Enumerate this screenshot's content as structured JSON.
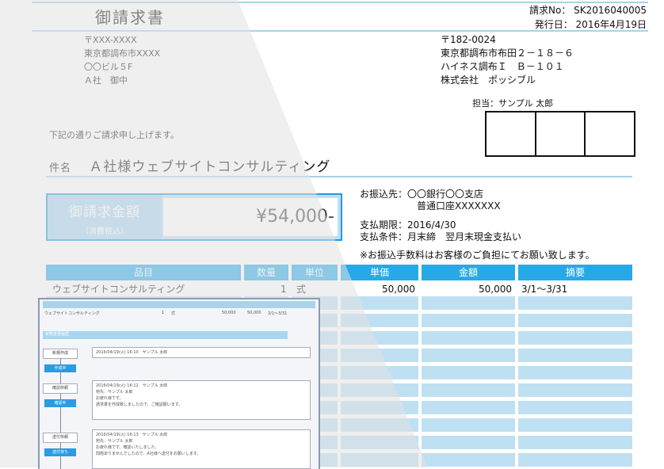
{
  "invoice": {
    "title": "御請求書",
    "number_line": "請求No： SK2016040005",
    "issue_line": "発行日： 2016年4月19日"
  },
  "recipient": {
    "postal": "〒XXX-XXXX",
    "address": "東京都調布市XXXX",
    "building": "〇〇ビル５F",
    "name": "Ａ社　御中"
  },
  "sender": {
    "postal": "〒182-0024",
    "address": "東京都調布市布田２－１８－６",
    "building": "ハイネス調布Ｉ　Ｂ－１０１",
    "company": "株式会社　ポッシブル",
    "person": "担当：サンプル 太郎"
  },
  "greeting": "下記の通りご請求申し上げます。",
  "subject": {
    "label": "件名",
    "value": "Ａ社様ウェブサイトコンサルティング"
  },
  "amount": {
    "label": "御請求金額",
    "sublabel": "（消費税込）",
    "value": "¥54,000-"
  },
  "payment": {
    "bank_label": "お振込先：",
    "bank": "〇〇銀行〇〇支店",
    "account": "普通口座XXXXXXX",
    "deadline": "支払期限：2016/4/30",
    "terms": "支払条件：月末締　翌月末現金支払い",
    "note": "※お振込手数料はお客様のご負担にてお願い致します。"
  },
  "table": {
    "headers": [
      "品目",
      "数量",
      "単位",
      "単価",
      "金額",
      "摘要"
    ],
    "rows": [
      {
        "item": "ウェブサイトコンサルティング",
        "qty": "1",
        "unit": "式",
        "price": "50,000",
        "amount": "50,000",
        "memo": "3/1～3/31"
      }
    ]
  },
  "inset": {
    "row_item": "ウェブサイトコンサルティング",
    "row_qty": "1",
    "row_unit": "式",
    "row_price": "50,000",
    "row_amount": "50,000",
    "row_memo": "3/1～3/31",
    "section": "状態変更履歴",
    "steps": [
      {
        "step": "新規作成",
        "badge": "作成中",
        "line1": "2016/04/19(火) 16:10　サンプル 太郎",
        "line2": "",
        "line3": "",
        "line4": ""
      },
      {
        "step": "確認依頼",
        "badge": "確認中",
        "line1": "2016/04/19(火) 16:12　サンプル 太郎",
        "line2": "宛先：サンプル 太郎",
        "line3": "お疲れ様です。",
        "line4": "請求書を作成致しましたので、ご確認願います。"
      },
      {
        "step": "送付依頼",
        "badge": "送付待ち",
        "line1": "2016/04/19(火) 16:13　サンプル 太郎",
        "line2": "宛先：サンプル 太郎",
        "line3": "お疲れ様です。確認いたしました。",
        "line4": "問題ありませんでしたので、A社様へ送付をお願いします。"
      }
    ]
  }
}
